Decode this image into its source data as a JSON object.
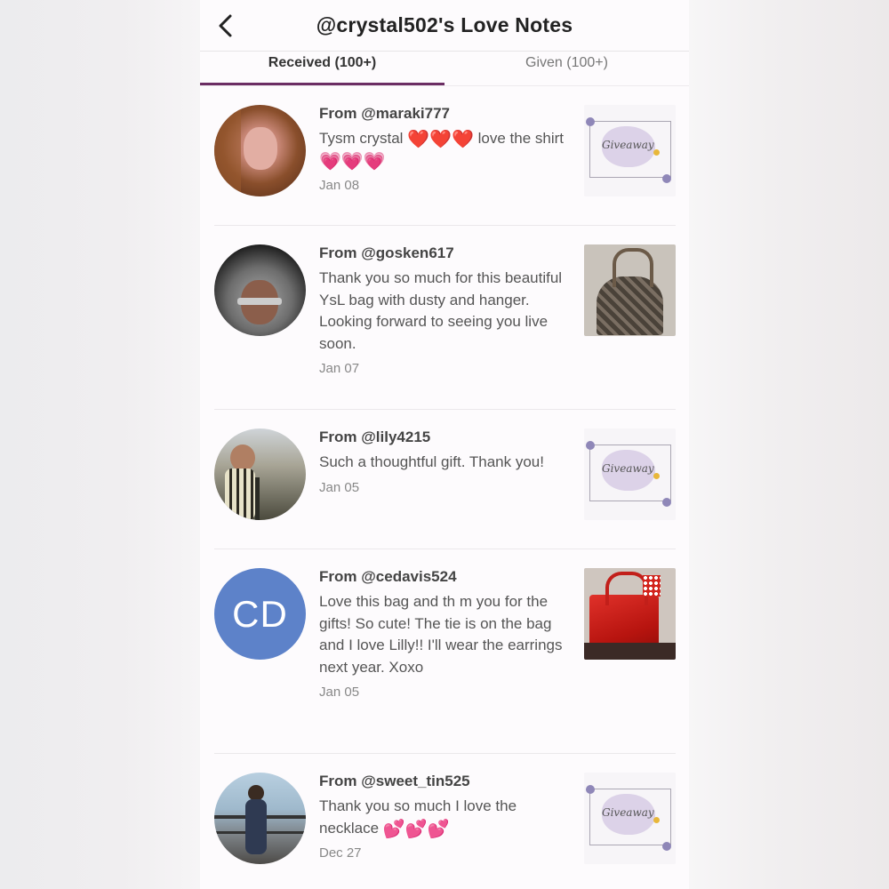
{
  "header": {
    "title": "@crystal502's Love Notes"
  },
  "tabs": [
    {
      "label": "Received (100+)",
      "active": true
    },
    {
      "label": "Given (100+)",
      "active": false
    }
  ],
  "notes": [
    {
      "from": "From @maraki777",
      "message_parts": [
        "Tysm crystal ",
        "❤️❤️❤️",
        " love the shirt ",
        "💗💗💗"
      ],
      "date": "Jan 08",
      "thumb": "giveaway"
    },
    {
      "from": "From @gosken617",
      "message": "Thank you so much for this beautiful YsL bag with dusty and hanger. Looking forward to seeing you live soon.",
      "date": "Jan 07",
      "thumb": "bag-dark"
    },
    {
      "from": "From @lily4215",
      "message": "Such a thoughtful gift. Thank you!",
      "date": "Jan 05",
      "thumb": "giveaway"
    },
    {
      "from": "From @cedavis524",
      "avatar_initials": "CD",
      "message": "Love this bag and th m you for the gifts! So cute! The tie is on the bag and I love Lilly!! I'll wear the earrings next year. Xoxo",
      "date": "Jan 05",
      "thumb": "bag-red"
    },
    {
      "from": "From @sweet_tin525",
      "message_parts": [
        "Thank you so much I love the necklace ",
        "💕💕💕"
      ],
      "date": "Dec 27",
      "thumb": "giveaway"
    }
  ],
  "giveaway_text": "Giveaway",
  "colors": {
    "accent": "#6b2d63",
    "avatar_initials_bg": "#5d82c9"
  }
}
